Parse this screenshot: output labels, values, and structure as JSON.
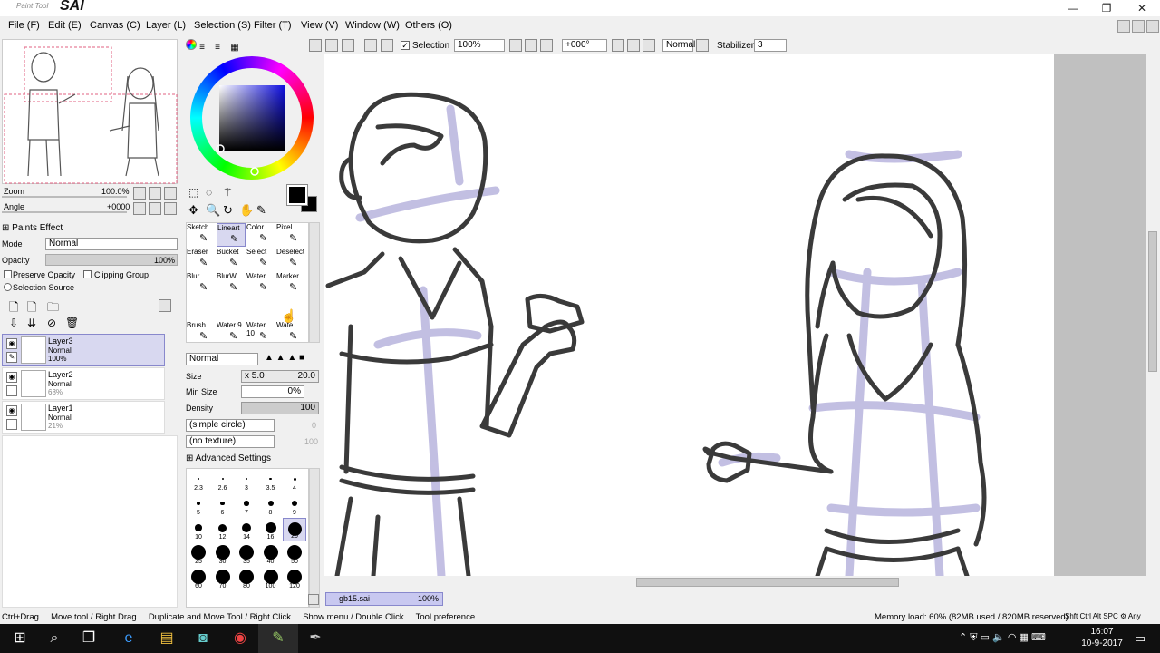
{
  "app": {
    "logo_small": "Paint Tool",
    "logo_big": "SAI"
  },
  "window_controls": {
    "minimize": "—",
    "maximize": "❐",
    "close": "✕"
  },
  "menu": [
    "File (F)",
    "Edit (E)",
    "Canvas (C)",
    "Layer (L)",
    "Selection (S)",
    "Filter (T)",
    "View (V)",
    "Window (W)",
    "Others (O)"
  ],
  "toolbar": {
    "selection_label": "Selection",
    "zoom": "100%",
    "rotation": "+000°",
    "blend": "Normal",
    "stabilizer_label": "Stabilizer",
    "stabilizer_value": "3"
  },
  "navigator": {
    "zoom_label": "Zoom",
    "zoom_value": "100.0%",
    "angle_label": "Angle",
    "angle_value": "+0000"
  },
  "paints_effect": {
    "header": "Paints Effect",
    "mode_label": "Mode",
    "mode_value": "Normal",
    "opacity_label": "Opacity",
    "opacity_value": "100%",
    "preserve_opacity": "Preserve Opacity",
    "clipping_group": "Clipping Group",
    "selection_source": "Selection Source"
  },
  "layers": [
    {
      "name": "Layer3",
      "mode": "Normal",
      "opacity": "100%"
    },
    {
      "name": "Layer2",
      "mode": "Normal",
      "opacity": "68%"
    },
    {
      "name": "Layer1",
      "mode": "Normal",
      "opacity": "21%"
    }
  ],
  "brushes": [
    {
      "label": "Sketch"
    },
    {
      "label": "Lineart"
    },
    {
      "label": "Color"
    },
    {
      "label": "Pixel"
    },
    {
      "label": "Eraser"
    },
    {
      "label": "Bucket"
    },
    {
      "label": "Select"
    },
    {
      "label": "Deselect"
    },
    {
      "label": "Blur"
    },
    {
      "label": "BlurW"
    },
    {
      "label": "Water"
    },
    {
      "label": "Marker"
    },
    {
      "label": "Brush"
    },
    {
      "label": "Water 9"
    },
    {
      "label": "Water 10"
    },
    {
      "label": "Wate"
    }
  ],
  "tool_settings": {
    "blend_mode": "Normal",
    "size_label": "Size",
    "size_mult": "x 5.0",
    "size_value": "20.0",
    "minsize_label": "Min Size",
    "minsize_value": "0%",
    "density_label": "Density",
    "density_value": "100",
    "shape": "(simple circle)",
    "shape_value": "0",
    "texture": "(no texture)",
    "texture_value": "100",
    "advanced": "Advanced Settings"
  },
  "brush_sizes": [
    "2.3",
    "2.6",
    "3",
    "3.5",
    "4",
    "5",
    "6",
    "7",
    "8",
    "9",
    "10",
    "12",
    "14",
    "16",
    "20",
    "25",
    "30",
    "35",
    "40",
    "50",
    "60",
    "70",
    "80",
    "100",
    "120"
  ],
  "document_tab": {
    "name": "gb15.sai",
    "zoom": "100%"
  },
  "status": {
    "hint": "Ctrl+Drag ... Move tool / Right Drag ... Duplicate and Move Tool / Right Click ... Show menu / Double Click ... Tool preference",
    "memory": "Memory load: 60% (82MB used / 820MB reserved)",
    "keys": [
      "Shft",
      "Ctrl",
      "Alt",
      "SPC"
    ],
    "any": "Any"
  },
  "taskbar": {
    "time": "16:07",
    "date": "10-9-2017"
  },
  "colors": {
    "selection": "#d8d8f0",
    "sketch_blue": "#b4b0dc",
    "ink": "#3a3a3a"
  }
}
